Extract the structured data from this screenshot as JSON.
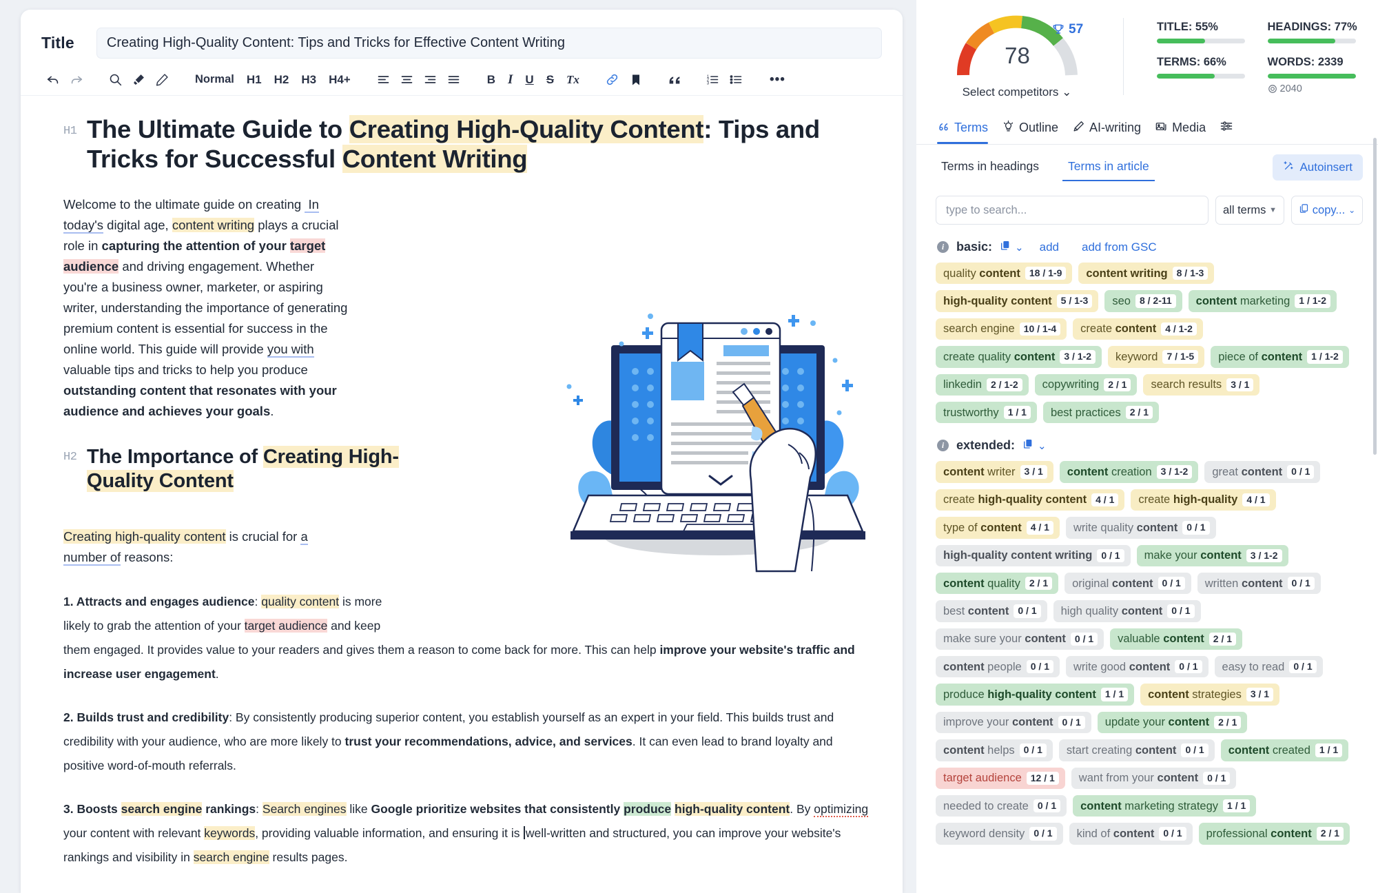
{
  "editor": {
    "title_label": "Title",
    "title_value": "Creating High-Quality Content: Tips and Tricks for Effective Content Writing",
    "toolbar": {
      "undo": "↶",
      "redo": "↷",
      "styles": [
        "Normal",
        "H1",
        "H2",
        "H3",
        "H4+"
      ],
      "bold": "B",
      "italic": "I",
      "underline": "U",
      "strike": "S",
      "clear": "Tx",
      "more": "•••"
    },
    "article": {
      "h1_tag": "H1",
      "h1_parts": [
        {
          "t": "The Ultimate Guide to ",
          "hl": "none"
        },
        {
          "t": "Creating High-Quality Content",
          "hl": "yellow"
        },
        {
          "t": ": Tips and Tricks for Successful ",
          "hl": "none"
        },
        {
          "t": "Content Writing",
          "hl": "yellow"
        }
      ],
      "h1_plain": "The Ultimate Guide to Creating High-Quality Content: Tips and Tricks for Successful Content Writing",
      "intro": "Welcome to the ultimate guide on creating  In today's digital age, content writing plays a crucial role in capturing the attention of your target audience and driving engagement. Whether you're a business owner, marketer, or aspiring writer, understanding the importance of generating premium content is essential for success in the online world. This guide will provide you with valuable tips and tricks to help you produce outstanding content that resonates with your audience and achieves your goals.",
      "h2_tag": "H2",
      "h2_plain": "The Importance of Creating High-Quality Content",
      "lead": "Creating high-quality content is crucial for a number of reasons:",
      "item1": "1. Attracts and engages audience: quality content is more likely to grab the attention of your target audience and keep them engaged. It provides value to your readers and gives them a reason to come back for more. This can help improve your website's traffic and increase user engagement.",
      "item2": "2. Builds trust and credibility: By consistently producing superior content, you establish yourself as an expert in your field. This builds trust and credibility with your audience, who are more likely to trust your recommendations, advice, and services. It can even lead to brand loyalty and positive word-of-mouth referrals.",
      "item3": "3. Boosts search engine rankings: Search engines like Google prioritize websites that consistently produce high-quality content. By optimizing your content with relevant keywords, providing valuable information, and ensuring it is well-written and structured, you can improve your website's rankings and visibility in search engine results pages.",
      "image_alt": "laptop-document-pencil-illustration"
    }
  },
  "panel": {
    "score": {
      "value": "78",
      "competitor_score": "57",
      "select_competitors": "Select competitors",
      "chevron": "⌄"
    },
    "metrics": [
      {
        "label": "TITLE: 55%",
        "pct": 55
      },
      {
        "label": "HEADINGS: 77%",
        "pct": 77
      },
      {
        "label": "TERMS: 66%",
        "pct": 66
      },
      {
        "label": "WORDS: 2339",
        "pct": 100,
        "target": "2040"
      }
    ],
    "tabs": [
      {
        "label": "Terms",
        "icon": "quote-icon",
        "active": true
      },
      {
        "label": "Outline",
        "icon": "lightbulb-icon",
        "active": false
      },
      {
        "label": "AI-writing",
        "icon": "pen-icon",
        "active": false
      },
      {
        "label": "Media",
        "icon": "image-icon",
        "active": false
      },
      {
        "label": "",
        "icon": "sliders-icon",
        "active": false
      }
    ],
    "subtabs": [
      {
        "label": "Terms in headings",
        "active": false
      },
      {
        "label": "Terms in article",
        "active": true
      }
    ],
    "autoinsert_label": "Autoinsert",
    "search_placeholder": "type to search...",
    "filter_value": "all terms",
    "copy_label": "copy...",
    "groups": [
      {
        "name": "basic:",
        "links": [
          "add",
          "add from GSC"
        ],
        "chips": [
          {
            "pre": "quality ",
            "bold": "content",
            "post": "",
            "count": "18 / 1-9",
            "color": "y"
          },
          {
            "pre": "",
            "bold": "content writing",
            "post": "",
            "count": "8 / 1-3",
            "color": "y"
          },
          {
            "pre": "",
            "bold": "high-quality content",
            "post": "",
            "count": "5 / 1-3",
            "color": "y"
          },
          {
            "pre": "seo",
            "bold": "",
            "post": "",
            "count": "8 / 2-11",
            "color": "g"
          },
          {
            "pre": "",
            "bold": "content",
            "post": " marketing",
            "count": "1 / 1-2",
            "color": "g"
          },
          {
            "pre": "search engine",
            "bold": "",
            "post": "",
            "count": "10 / 1-4",
            "color": "y"
          },
          {
            "pre": "create ",
            "bold": "content",
            "post": "",
            "count": "4 / 1-2",
            "color": "y"
          },
          {
            "pre": "create quality ",
            "bold": "content",
            "post": "",
            "count": "3 / 1-2",
            "color": "g"
          },
          {
            "pre": "keyword",
            "bold": "",
            "post": "",
            "count": "7 / 1-5",
            "color": "y"
          },
          {
            "pre": "piece of ",
            "bold": "content",
            "post": "",
            "count": "1 / 1-2",
            "color": "g"
          },
          {
            "pre": "linkedin",
            "bold": "",
            "post": "",
            "count": "2 / 1-2",
            "color": "g"
          },
          {
            "pre": "copywriting",
            "bold": "",
            "post": "",
            "count": "2 / 1",
            "color": "g"
          },
          {
            "pre": "search results",
            "bold": "",
            "post": "",
            "count": "3 / 1",
            "color": "y"
          },
          {
            "pre": "trustworthy",
            "bold": "",
            "post": "",
            "count": "1 / 1",
            "color": "g"
          },
          {
            "pre": "best practices",
            "bold": "",
            "post": "",
            "count": "2 / 1",
            "color": "g"
          }
        ]
      },
      {
        "name": "extended:",
        "links": [],
        "chips": [
          {
            "pre": "",
            "bold": "content",
            "post": " writer",
            "count": "3 / 1",
            "color": "y"
          },
          {
            "pre": "",
            "bold": "content",
            "post": " creation",
            "count": "3 / 1-2",
            "color": "g"
          },
          {
            "pre": "great ",
            "bold": "content",
            "post": "",
            "count": "0 / 1",
            "color": "e"
          },
          {
            "pre": "create ",
            "bold": "high-quality content",
            "post": "",
            "count": "4 / 1",
            "color": "y"
          },
          {
            "pre": "create ",
            "bold": "high-quality",
            "post": "",
            "count": "4 / 1",
            "color": "y"
          },
          {
            "pre": "type of ",
            "bold": "content",
            "post": "",
            "count": "4 / 1",
            "color": "y"
          },
          {
            "pre": "write quality ",
            "bold": "content",
            "post": "",
            "count": "0 / 1",
            "color": "e"
          },
          {
            "pre": "",
            "bold": "high-quality content writing",
            "post": "",
            "count": "0 / 1",
            "color": "e"
          },
          {
            "pre": "make your ",
            "bold": "content",
            "post": "",
            "count": "3 / 1-2",
            "color": "g"
          },
          {
            "pre": "",
            "bold": "content",
            "post": " quality",
            "count": "2 / 1",
            "color": "g"
          },
          {
            "pre": "original ",
            "bold": "content",
            "post": "",
            "count": "0 / 1",
            "color": "e"
          },
          {
            "pre": "written ",
            "bold": "content",
            "post": "",
            "count": "0 / 1",
            "color": "e"
          },
          {
            "pre": "best ",
            "bold": "content",
            "post": "",
            "count": "0 / 1",
            "color": "e"
          },
          {
            "pre": "high quality ",
            "bold": "content",
            "post": "",
            "count": "0 / 1",
            "color": "e"
          },
          {
            "pre": "make sure your ",
            "bold": "content",
            "post": "",
            "count": "0 / 1",
            "color": "e"
          },
          {
            "pre": "valuable ",
            "bold": "content",
            "post": "",
            "count": "2 / 1",
            "color": "g"
          },
          {
            "pre": "",
            "bold": "content",
            "post": " people",
            "count": "0 / 1",
            "color": "e"
          },
          {
            "pre": "write good ",
            "bold": "content",
            "post": "",
            "count": "0 / 1",
            "color": "e"
          },
          {
            "pre": "easy to read",
            "bold": "",
            "post": "",
            "count": "0 / 1",
            "color": "e"
          },
          {
            "pre": "produce ",
            "bold": "high-quality content",
            "post": "",
            "count": "1 / 1",
            "color": "g"
          },
          {
            "pre": "",
            "bold": "content",
            "post": " strategies",
            "count": "3 / 1",
            "color": "y"
          },
          {
            "pre": "improve your ",
            "bold": "content",
            "post": "",
            "count": "0 / 1",
            "color": "e"
          },
          {
            "pre": "update your ",
            "bold": "content",
            "post": "",
            "count": "2 / 1",
            "color": "g"
          },
          {
            "pre": "",
            "bold": "content",
            "post": " helps",
            "count": "0 / 1",
            "color": "e"
          },
          {
            "pre": "start creating ",
            "bold": "content",
            "post": "",
            "count": "0 / 1",
            "color": "e"
          },
          {
            "pre": "",
            "bold": "content",
            "post": " created",
            "count": "1 / 1",
            "color": "g"
          },
          {
            "pre": "target audience",
            "bold": "",
            "post": "",
            "count": "12 / 1",
            "color": "r"
          },
          {
            "pre": "want from your ",
            "bold": "content",
            "post": "",
            "count": "0 / 1",
            "color": "e"
          },
          {
            "pre": "needed to create",
            "bold": "",
            "post": "",
            "count": "0 / 1",
            "color": "e"
          },
          {
            "pre": "",
            "bold": "content",
            "post": " marketing strategy",
            "count": "1 / 1",
            "color": "g"
          },
          {
            "pre": "keyword density",
            "bold": "",
            "post": "",
            "count": "0 / 1",
            "color": "e"
          },
          {
            "pre": "kind of ",
            "bold": "content",
            "post": "",
            "count": "0 / 1",
            "color": "e"
          },
          {
            "pre": "professional ",
            "bold": "content",
            "post": "",
            "count": "2 / 1",
            "color": "g"
          }
        ]
      }
    ]
  },
  "colors": {
    "accent": "#2f6fdc",
    "green": "#46bd5b",
    "chip_yellow": "#f8edc4",
    "chip_green": "#c8e6cd",
    "chip_grey": "#e8eaec",
    "chip_red": "#f8d4d2",
    "highlight_yellow": "#fbeec8",
    "highlight_pink": "#f9d8d6"
  }
}
